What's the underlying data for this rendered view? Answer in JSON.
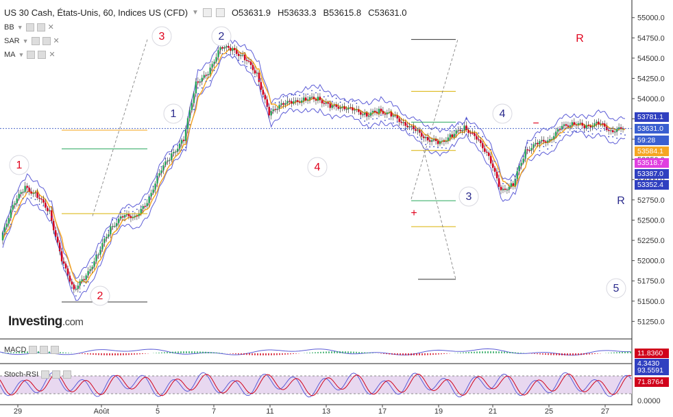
{
  "header": {
    "symbol": "US 30 Cash, États-Unis, 60, Indices US (CFD)",
    "open": "O53631.9",
    "high": "H53633.3",
    "low": "B53615.8",
    "close": "C53631.0"
  },
  "indicators": [
    "BB",
    "SAR",
    "MA"
  ],
  "logo": {
    "name": "Investing",
    "suffix": ".com"
  },
  "sub_panels": {
    "macd_label": "MACD",
    "stochrsi_label": "Stoch-RSI"
  },
  "colors": {
    "up_candle": "#26a65b",
    "down_candle": "#d0021b",
    "bollinger": "#5b5bd6",
    "ma": "#f5a623",
    "sar": "#3040c0",
    "current_price": "#3050c0",
    "wave_red": "#e0001b",
    "wave_blue": "#2a2a8c",
    "stoch_fill": "#e8d8f0"
  },
  "chart_data": {
    "type": "line",
    "series": [
      {
        "values": [
          52250,
          52700,
          52900,
          52800,
          52600,
          52000,
          51650,
          51800,
          52100,
          52400,
          52550,
          52550,
          52700,
          53100,
          53300,
          53500,
          54200,
          54300,
          54650,
          54600,
          54500,
          54300,
          53800,
          53950,
          53950,
          54000,
          54000,
          53900,
          53900,
          53850,
          53800,
          53850,
          53800,
          53700,
          53600,
          53500,
          53450,
          53550,
          53650,
          53500,
          53300,
          52850,
          52950,
          53350,
          53450,
          53500,
          53650,
          53700,
          53650,
          53700,
          53600,
          53631
        ]
      }
    ],
    "x_tick_labels": [
      "29",
      "Août",
      "5",
      "7",
      "11",
      "13",
      "17",
      "19",
      "21",
      "25",
      "27"
    ],
    "y_tick_labels": [
      "55000.0",
      "54750.0",
      "54500.0",
      "54250.0",
      "54000.0",
      "53750.0",
      "53500.0",
      "53250.0",
      "53000.0",
      "52750.0",
      "52500.0",
      "52250.0",
      "52000.0",
      "51750.0",
      "51500.0",
      "51250.0"
    ],
    "ylim": [
      51050,
      55150
    ],
    "price_boxes": [
      {
        "label": "53781.1",
        "color": "#3040c0"
      },
      {
        "label": "53631.0",
        "color": "#3a5fd0"
      },
      {
        "label": "59:28",
        "color": "#3a5fd0"
      },
      {
        "label": "53584.1",
        "color": "#f5a623"
      },
      {
        "label": "53518.7",
        "color": "#e040e0"
      },
      {
        "label": "53387.0",
        "color": "#3040c0"
      },
      {
        "label": "53352.4",
        "color": "#3040c0"
      }
    ],
    "wave_labels": [
      {
        "text": "1",
        "color": "red"
      },
      {
        "text": "2",
        "color": "red"
      },
      {
        "text": "3",
        "color": "red"
      },
      {
        "text": "1",
        "color": "blue"
      },
      {
        "text": "2",
        "color": "blue"
      },
      {
        "text": "4",
        "color": "red"
      },
      {
        "text": "3",
        "color": "blue"
      },
      {
        "text": "4",
        "color": "blue"
      },
      {
        "text": "5",
        "color": "blue"
      },
      {
        "text": "R",
        "color": "red"
      },
      {
        "text": "R",
        "color": "blue"
      },
      {
        "text": "+",
        "color": "red"
      },
      {
        "text": "−",
        "color": "red"
      }
    ],
    "macd_values": [
      "11.8360",
      "4.3430"
    ],
    "stoch_rsi_values": [
      "93.5591",
      "71.8764"
    ],
    "stoch_ticks": [
      "0.0000"
    ]
  }
}
